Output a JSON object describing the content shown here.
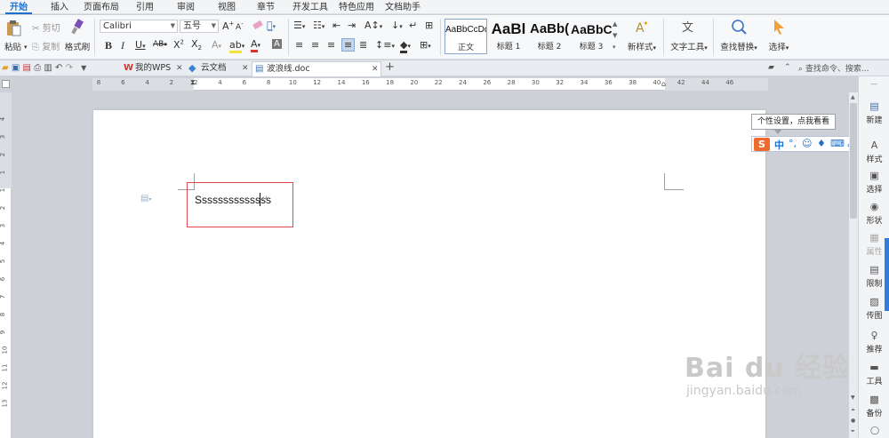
{
  "menu": {
    "tabs": [
      "开始",
      "插入",
      "页面布局",
      "引用",
      "审阅",
      "视图",
      "章节",
      "开发工具",
      "特色应用",
      "文档助手"
    ],
    "active": "开始"
  },
  "ribbon": {
    "paste": "粘贴",
    "cut": "剪切",
    "copy": "复制",
    "format_painter": "格式刷",
    "font_name": "Calibri",
    "font_size": "五号",
    "styles": [
      {
        "preview": "AaBbCcDd",
        "label": "正文"
      },
      {
        "preview": "AaBl",
        "label": "标题 1"
      },
      {
        "preview": "AaBb(",
        "label": "标题 2"
      },
      {
        "preview": "AaBbC",
        "label": "标题 3"
      }
    ],
    "new_style": "新样式",
    "text_tools": "文字工具",
    "find_replace": "查找替换",
    "select": "选择"
  },
  "tabstrip": {
    "my_wps": "我的WPS",
    "cloud_docs": "云文档",
    "doc_name": "波浪线.doc",
    "search_placeholder": "查找命令、搜索..."
  },
  "ruler": {
    "h_labels": [
      "8",
      "6",
      "4",
      "2",
      "2",
      "4",
      "6",
      "8",
      "10",
      "12",
      "14",
      "16",
      "18",
      "20",
      "22",
      "24",
      "26",
      "28",
      "30",
      "32",
      "34",
      "36",
      "38",
      "40",
      "42",
      "44",
      "46"
    ],
    "v_labels": [
      "4",
      "3",
      "2",
      "1",
      "1",
      "2",
      "3",
      "4",
      "5",
      "6",
      "7",
      "8",
      "9",
      "10",
      "11",
      "12",
      "13"
    ]
  },
  "document": {
    "text": "Ssssssssssssss"
  },
  "tooltip": "个性设置，点我看看",
  "ime": {
    "mode": "中"
  },
  "sidepanel": [
    "新建",
    "样式",
    "选择",
    "形状",
    "属性",
    "限制",
    "传图",
    "推荐",
    "工具",
    "备份"
  ],
  "watermark": {
    "main": "Bai du 经验",
    "url": "jingyan.baidu.com"
  },
  "colors": {
    "accent": "#1d6fd0",
    "textbox_border": "#e0474c",
    "ime_orange": "#ef6a2e"
  }
}
